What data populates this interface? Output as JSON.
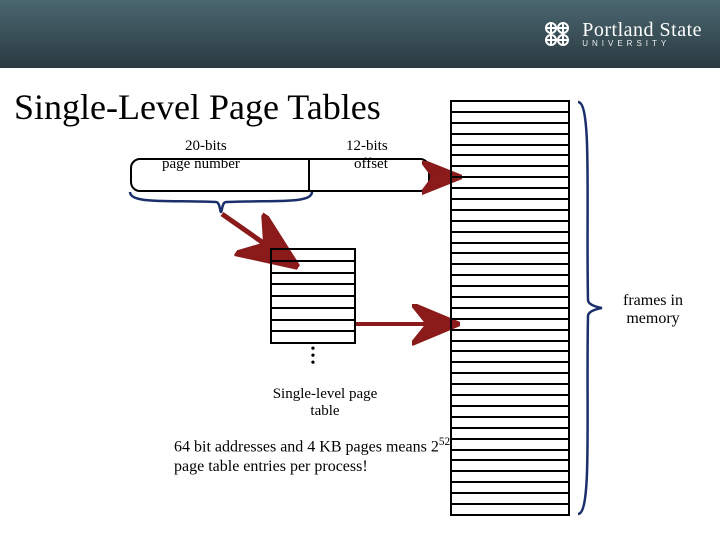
{
  "header": {
    "org_main": "Portland State",
    "org_sub": "UNIVERSITY"
  },
  "title": "Single-Level Page Tables",
  "address": {
    "page_number_bits": "20-bits",
    "page_number_label": "page number",
    "offset_bits": "12-bits",
    "offset_label": "offset"
  },
  "page_table": {
    "rows": 8,
    "caption": "Single-level page table"
  },
  "memory": {
    "frames": 38,
    "caption": "frames in memory"
  },
  "note": {
    "line1": "64 bit addresses and 4 KB pages means 2",
    "exp": "52",
    "line2": " page table entries per process!"
  }
}
